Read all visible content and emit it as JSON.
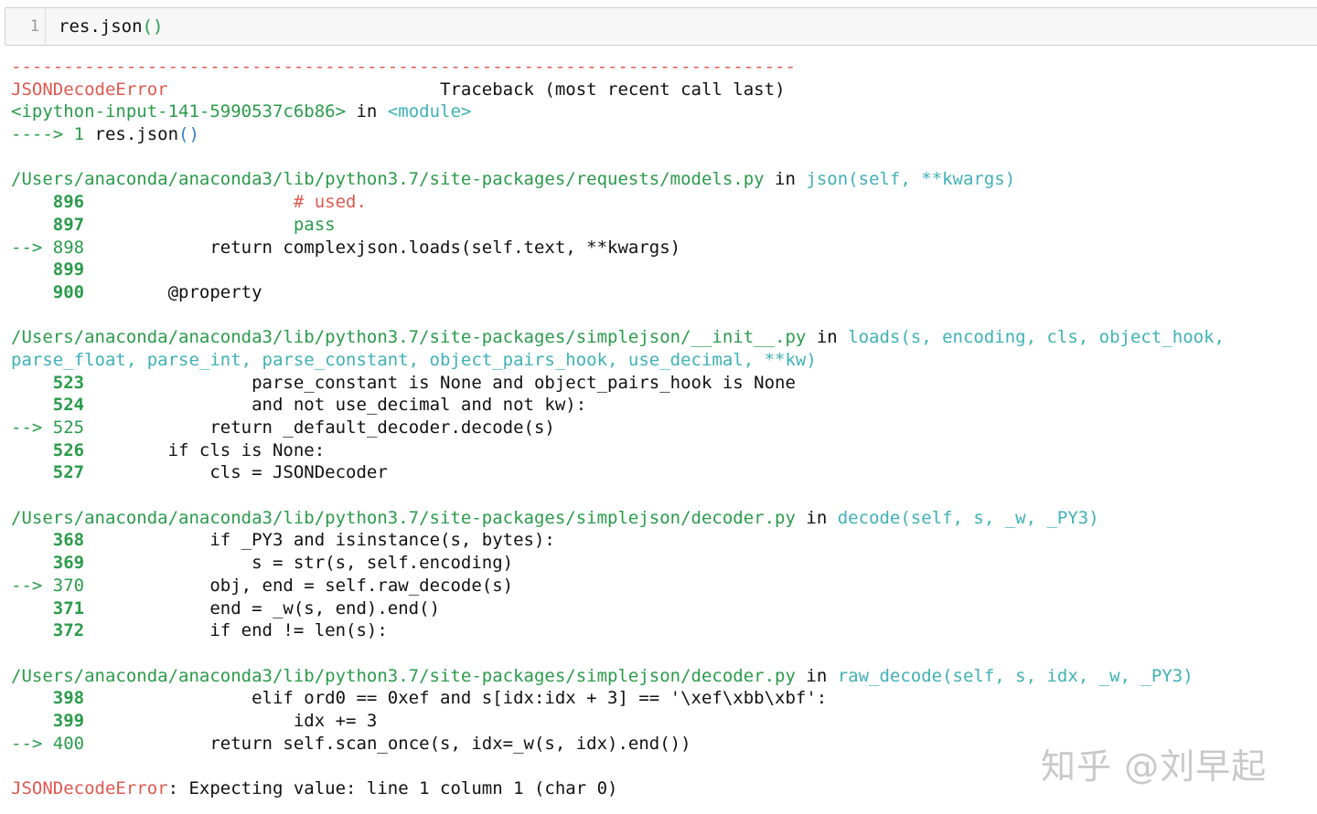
{
  "input_cell": {
    "line_number": "1",
    "code_obj": "res",
    "code_call": ".json",
    "code_parens": "()"
  },
  "traceback": {
    "dashes": "---------------------------------------------------------------------------",
    "error_name": "JSONDecodeError",
    "header_gap": "                          ",
    "header_text": "Traceback (most recent call last)",
    "input_ref": "<ipython-input-141-5990537c6b86>",
    "in_word": " in ",
    "module": "<module>",
    "arrow_prefix": "----> 1 ",
    "arrow_code": "res",
    "arrow_code2": ".json",
    "arrow_parens": "()"
  },
  "frames": [
    {
      "path": "/Users/anaconda/anaconda3/lib/python3.7/site-packages/requests/models.py",
      "in_word": " in ",
      "func": "json(self, **kwargs)",
      "func_cont": "",
      "lines": [
        {
          "num": "    896",
          "arrow": "",
          "code": "                    # used.",
          "style": "red"
        },
        {
          "num": "    897",
          "arrow": "",
          "code": "                    pass",
          "style": "green"
        },
        {
          "num": "898",
          "arrow": "--> ",
          "code": "            return complexjson.loads(self.text, **kwargs)",
          "style": "mixed"
        },
        {
          "num": "    899",
          "arrow": "",
          "code": "",
          "style": "plain"
        },
        {
          "num": "    900",
          "arrow": "",
          "code": "        @property",
          "style": "plain"
        }
      ]
    },
    {
      "path": "/Users/anaconda/anaconda3/lib/python3.7/site-packages/simplejson/__init__.py",
      "in_word": " in ",
      "func": "loads(s, encoding, cls, object_hook,",
      "func_cont": "parse_float, parse_int, parse_constant, object_pairs_hook, use_decimal, **kw)",
      "lines": [
        {
          "num": "    523",
          "arrow": "",
          "code": "                parse_constant is None and object_pairs_hook is None",
          "style": "plain"
        },
        {
          "num": "    524",
          "arrow": "",
          "code": "                and not use_decimal and not kw):",
          "style": "plain"
        },
        {
          "num": "525",
          "arrow": "--> ",
          "code": "            return _default_decoder.decode(s)",
          "style": "plain"
        },
        {
          "num": "    526",
          "arrow": "",
          "code": "        if cls is None:",
          "style": "plain"
        },
        {
          "num": "    527",
          "arrow": "",
          "code": "            cls = JSONDecoder",
          "style": "plain"
        }
      ]
    },
    {
      "path": "/Users/anaconda/anaconda3/lib/python3.7/site-packages/simplejson/decoder.py",
      "in_word": " in ",
      "func": "decode(self, s, _w, _PY3)",
      "func_cont": "",
      "lines": [
        {
          "num": "    368",
          "arrow": "",
          "code": "            if _PY3 and isinstance(s, bytes):",
          "style": "plain"
        },
        {
          "num": "    369",
          "arrow": "",
          "code": "                s = str(s, self.encoding)",
          "style": "plain"
        },
        {
          "num": "370",
          "arrow": "--> ",
          "code": "            obj, end = self.raw_decode(s)",
          "style": "plain"
        },
        {
          "num": "    371",
          "arrow": "",
          "code": "            end = _w(s, end).end()",
          "style": "plain"
        },
        {
          "num": "    372",
          "arrow": "",
          "code": "            if end != len(s):",
          "style": "plain"
        }
      ]
    },
    {
      "path": "/Users/anaconda/anaconda3/lib/python3.7/site-packages/simplejson/decoder.py",
      "in_word": " in ",
      "func": "raw_decode(self, s, idx, _w, _PY3)",
      "func_cont": "",
      "lines": [
        {
          "num": "    398",
          "arrow": "",
          "code": "                elif ord0 == 0xef and s[idx:idx + 3] == '\\xef\\xbb\\xbf':",
          "style": "plain"
        },
        {
          "num": "    399",
          "arrow": "",
          "code": "                    idx += 3",
          "style": "plain"
        },
        {
          "num": "400",
          "arrow": "--> ",
          "code": "            return self.scan_once(s, idx=_w(s, idx).end())",
          "style": "plain"
        }
      ]
    }
  ],
  "final_error": {
    "name": "JSONDecodeError",
    "message": ": Expecting value: line 1 column 1 (char 0)"
  },
  "watermark": "知乎 @刘早起",
  "colors": {
    "error_red": "#e0584f",
    "path_green": "#2a9b4a",
    "func_cyan": "#3fb1b7",
    "param_blue": "#3a7fc6"
  }
}
